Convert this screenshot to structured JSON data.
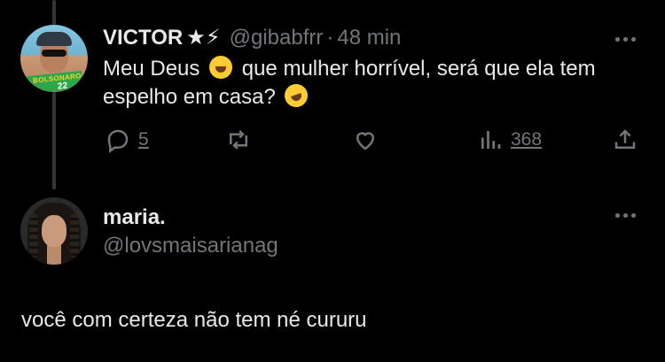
{
  "tweet": {
    "author_name": "VICTOR",
    "author_badge": "★⚡",
    "handle": "@gibabfrr",
    "separator": "·",
    "time": "48 min",
    "avatar_band_text": "BOLSONARO",
    "avatar_band_number": "22",
    "text_part1": "Meu Deus",
    "text_part2": "que mulher horrível, será que ela tem espelho em casa?",
    "emoji1": "face-with-tears-of-joy",
    "emoji2": "rolling-on-the-floor-laughing",
    "actions": {
      "reply_count": "5",
      "retweet_count": "",
      "like_count": "",
      "views_count": "368"
    },
    "icons": [
      "reply-icon",
      "retweet-icon",
      "like-icon",
      "views-icon",
      "share-icon"
    ],
    "more_icon": "more-icon"
  },
  "reply": {
    "author_name": "maria.",
    "handle": "@lovsmaisarianag",
    "text": "você com certeza não tem né cururu",
    "more_icon": "more-icon"
  },
  "colors": {
    "background": "#000000",
    "primary_text": "#e7e9ea",
    "secondary_text": "#71767b",
    "thread_line": "#333639"
  }
}
